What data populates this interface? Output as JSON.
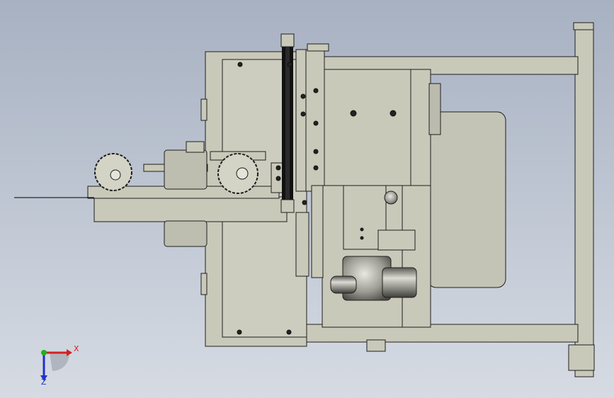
{
  "viewport": {
    "background_top": "#a8b1c2",
    "background_bottom": "#d6dbe3"
  },
  "model": {
    "part_fill": "#c9c9ba",
    "part_stroke": "#1e1e1e",
    "belt_color": "#111111",
    "casting_fill": "#8d8d86",
    "wire_color": "#000000"
  },
  "triad": {
    "x_label": "X",
    "z_label": "Z",
    "x_color": "#d42020",
    "y_color": "#20b020",
    "z_color": "#2030d0"
  }
}
